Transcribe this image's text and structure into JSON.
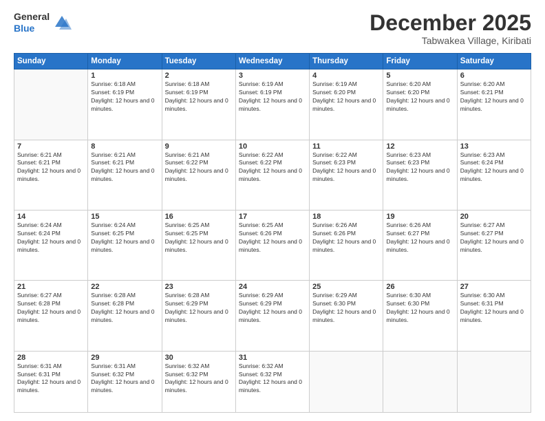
{
  "header": {
    "logo": {
      "general": "General",
      "blue": "Blue"
    },
    "title": "December 2025",
    "subtitle": "Tabwakea Village, Kiribati"
  },
  "calendar": {
    "weekdays": [
      "Sunday",
      "Monday",
      "Tuesday",
      "Wednesday",
      "Thursday",
      "Friday",
      "Saturday"
    ],
    "weeks": [
      [
        {
          "day": null
        },
        {
          "day": "1",
          "sunrise": "6:18 AM",
          "sunset": "6:19 PM",
          "daylight": "12 hours and 0 minutes."
        },
        {
          "day": "2",
          "sunrise": "6:18 AM",
          "sunset": "6:19 PM",
          "daylight": "12 hours and 0 minutes."
        },
        {
          "day": "3",
          "sunrise": "6:19 AM",
          "sunset": "6:19 PM",
          "daylight": "12 hours and 0 minutes."
        },
        {
          "day": "4",
          "sunrise": "6:19 AM",
          "sunset": "6:20 PM",
          "daylight": "12 hours and 0 minutes."
        },
        {
          "day": "5",
          "sunrise": "6:20 AM",
          "sunset": "6:20 PM",
          "daylight": "12 hours and 0 minutes."
        },
        {
          "day": "6",
          "sunrise": "6:20 AM",
          "sunset": "6:21 PM",
          "daylight": "12 hours and 0 minutes."
        }
      ],
      [
        {
          "day": "7",
          "sunrise": "6:21 AM",
          "sunset": "6:21 PM",
          "daylight": "12 hours and 0 minutes."
        },
        {
          "day": "8",
          "sunrise": "6:21 AM",
          "sunset": "6:21 PM",
          "daylight": "12 hours and 0 minutes."
        },
        {
          "day": "9",
          "sunrise": "6:21 AM",
          "sunset": "6:22 PM",
          "daylight": "12 hours and 0 minutes."
        },
        {
          "day": "10",
          "sunrise": "6:22 AM",
          "sunset": "6:22 PM",
          "daylight": "12 hours and 0 minutes."
        },
        {
          "day": "11",
          "sunrise": "6:22 AM",
          "sunset": "6:23 PM",
          "daylight": "12 hours and 0 minutes."
        },
        {
          "day": "12",
          "sunrise": "6:23 AM",
          "sunset": "6:23 PM",
          "daylight": "12 hours and 0 minutes."
        },
        {
          "day": "13",
          "sunrise": "6:23 AM",
          "sunset": "6:24 PM",
          "daylight": "12 hours and 0 minutes."
        }
      ],
      [
        {
          "day": "14",
          "sunrise": "6:24 AM",
          "sunset": "6:24 PM",
          "daylight": "12 hours and 0 minutes."
        },
        {
          "day": "15",
          "sunrise": "6:24 AM",
          "sunset": "6:25 PM",
          "daylight": "12 hours and 0 minutes."
        },
        {
          "day": "16",
          "sunrise": "6:25 AM",
          "sunset": "6:25 PM",
          "daylight": "12 hours and 0 minutes."
        },
        {
          "day": "17",
          "sunrise": "6:25 AM",
          "sunset": "6:26 PM",
          "daylight": "12 hours and 0 minutes."
        },
        {
          "day": "18",
          "sunrise": "6:26 AM",
          "sunset": "6:26 PM",
          "daylight": "12 hours and 0 minutes."
        },
        {
          "day": "19",
          "sunrise": "6:26 AM",
          "sunset": "6:27 PM",
          "daylight": "12 hours and 0 minutes."
        },
        {
          "day": "20",
          "sunrise": "6:27 AM",
          "sunset": "6:27 PM",
          "daylight": "12 hours and 0 minutes."
        }
      ],
      [
        {
          "day": "21",
          "sunrise": "6:27 AM",
          "sunset": "6:28 PM",
          "daylight": "12 hours and 0 minutes."
        },
        {
          "day": "22",
          "sunrise": "6:28 AM",
          "sunset": "6:28 PM",
          "daylight": "12 hours and 0 minutes."
        },
        {
          "day": "23",
          "sunrise": "6:28 AM",
          "sunset": "6:29 PM",
          "daylight": "12 hours and 0 minutes."
        },
        {
          "day": "24",
          "sunrise": "6:29 AM",
          "sunset": "6:29 PM",
          "daylight": "12 hours and 0 minutes."
        },
        {
          "day": "25",
          "sunrise": "6:29 AM",
          "sunset": "6:30 PM",
          "daylight": "12 hours and 0 minutes."
        },
        {
          "day": "26",
          "sunrise": "6:30 AM",
          "sunset": "6:30 PM",
          "daylight": "12 hours and 0 minutes."
        },
        {
          "day": "27",
          "sunrise": "6:30 AM",
          "sunset": "6:31 PM",
          "daylight": "12 hours and 0 minutes."
        }
      ],
      [
        {
          "day": "28",
          "sunrise": "6:31 AM",
          "sunset": "6:31 PM",
          "daylight": "12 hours and 0 minutes."
        },
        {
          "day": "29",
          "sunrise": "6:31 AM",
          "sunset": "6:32 PM",
          "daylight": "12 hours and 0 minutes."
        },
        {
          "day": "30",
          "sunrise": "6:32 AM",
          "sunset": "6:32 PM",
          "daylight": "12 hours and 0 minutes."
        },
        {
          "day": "31",
          "sunrise": "6:32 AM",
          "sunset": "6:32 PM",
          "daylight": "12 hours and 0 minutes."
        },
        {
          "day": null
        },
        {
          "day": null
        },
        {
          "day": null
        }
      ]
    ]
  }
}
